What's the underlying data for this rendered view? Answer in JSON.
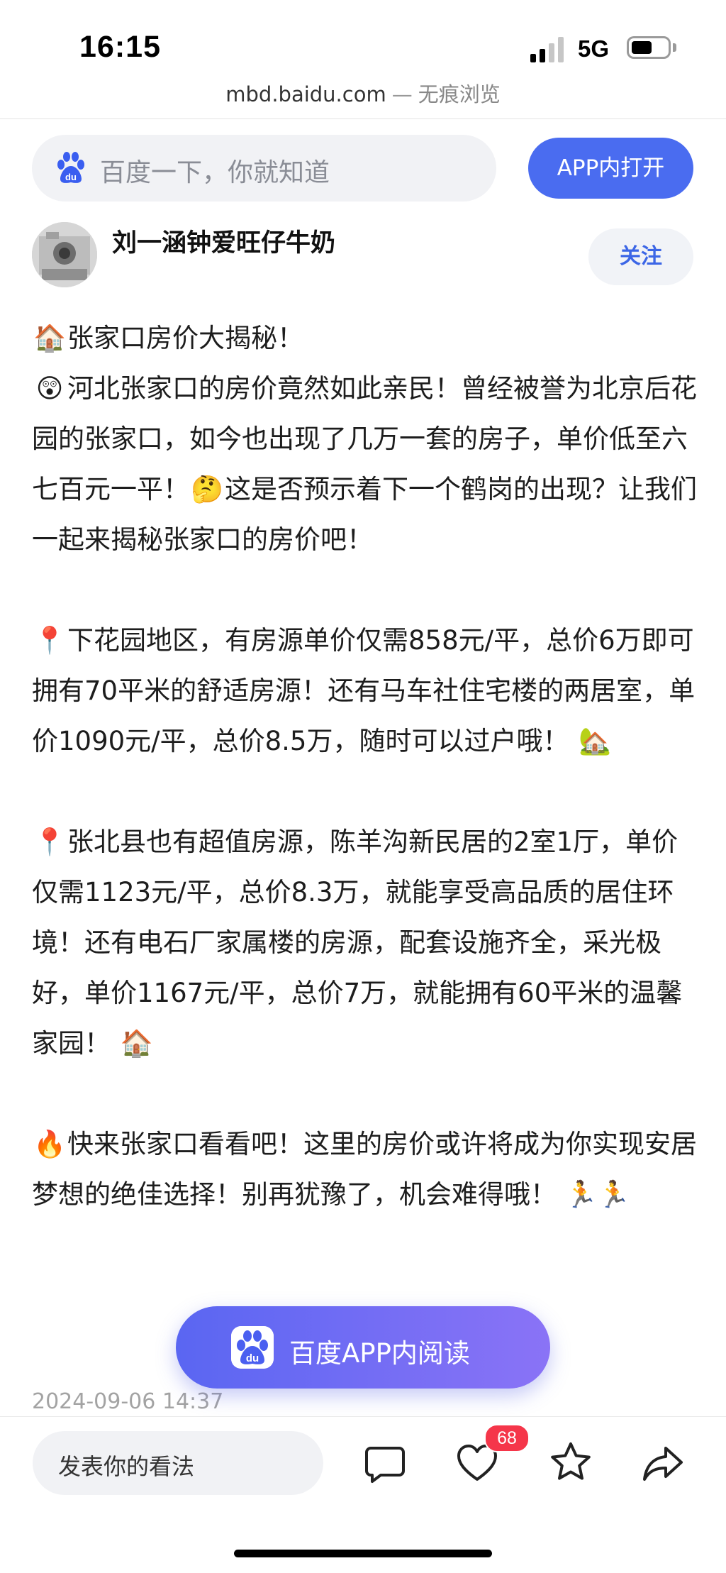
{
  "status_bar": {
    "time": "16:15",
    "network": "5G",
    "battery_level": 0.55
  },
  "browser": {
    "domain": "mbd.baidu.com",
    "separator": "—",
    "mode": "无痕浏览"
  },
  "search": {
    "placeholder": "百度一下，你就知道",
    "open_in_app_label": "APP内打开",
    "icon": "baidu-paw-icon"
  },
  "author": {
    "name": "刘一涵钟爱旺仔牛奶",
    "follow_label": "关注"
  },
  "article": {
    "p1": {
      "title_emoji": "🏠",
      "title": "张家口房价大揭秘！",
      "emoji1": "😲",
      "text1": "河北张家口的房价竟然如此亲民！曾经被誉为北京后花园的张家口，如今也出现了几万一套的房子，单价低至六七百元一平！",
      "emoji2": "🤔",
      "text2": "这是否预示着下一个鹤岗的出现？让我们一起来揭秘张家口的房价吧！"
    },
    "p2": {
      "emoji": "📍",
      "text": "下花园地区，有房源单价仅需858元/平，总价6万即可拥有70平米的舒适房源！还有马车社住宅楼的两居室，单价1090元/平，总价8.5万，随时可以过户哦！",
      "end_emoji": "🏡"
    },
    "p3": {
      "emoji": "📍",
      "text": "张北县也有超值房源，陈羊沟新民居的2室1厅，单价仅需1123元/平，总价8.3万，就能享受高品质的居住环境！还有电石厂家属楼的房源，配套设施齐全，采光极好，单价1167元/平，总价7万，就能拥有60平米的温馨家园！",
      "end_emoji": "🏠"
    },
    "p4": {
      "emoji": "🔥",
      "text": "快来张家口看看吧！这里的房价或许将成为你实现安居梦想的绝佳选择！别再犹豫了，机会难得哦！",
      "end_emoji": "🏃🏃"
    },
    "post_time": "2024-09-06 14:37"
  },
  "floating": {
    "read_in_app_label": "百度APP内阅读"
  },
  "bottom_bar": {
    "comment_placeholder": "发表你的看法",
    "like_count": "68",
    "icons": [
      "comment-icon",
      "like-heart-icon",
      "favorite-star-icon",
      "share-icon"
    ]
  },
  "colors": {
    "accent": "#4a6cf0",
    "follow_text": "#3c66e6",
    "badge": "#f5364a",
    "gradient_start": "#5a66f2",
    "gradient_end": "#8a73f6"
  }
}
